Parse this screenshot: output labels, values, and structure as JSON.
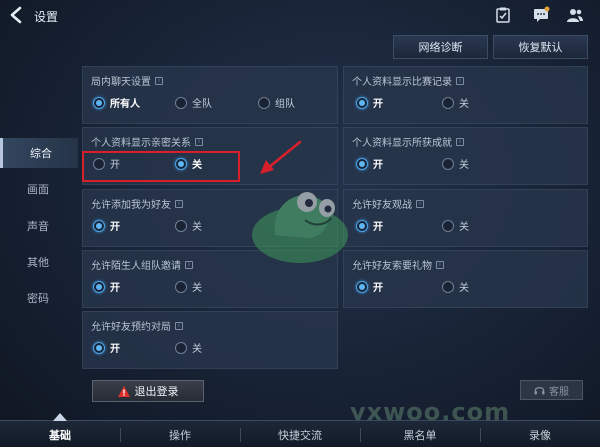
{
  "header": {
    "title": "设置"
  },
  "top_buttons": {
    "network": "网络诊断",
    "restore": "恢复默认"
  },
  "nav": [
    {
      "label": "综合",
      "active": true
    },
    {
      "label": "画面",
      "active": false
    },
    {
      "label": "声音",
      "active": false
    },
    {
      "label": "其他",
      "active": false
    },
    {
      "label": "密码",
      "active": false
    }
  ],
  "settings": {
    "ingame_chat": {
      "title": "局内聊天设置",
      "options": [
        "所有人",
        "全队",
        "组队"
      ],
      "selected": 0
    },
    "show_match_record": {
      "title": "个人资料显示比赛记录",
      "options": [
        "开",
        "关"
      ],
      "selected": 0
    },
    "show_intimacy": {
      "title": "个人资料显示亲密关系",
      "options": [
        "开",
        "关"
      ],
      "selected": 1
    },
    "show_achievements": {
      "title": "个人资料显示所获成就",
      "options": [
        "开",
        "关"
      ],
      "selected": 0
    },
    "allow_add_friend": {
      "title": "允许添加我为好友",
      "options": [
        "开",
        "关"
      ],
      "selected": 0
    },
    "allow_spectate": {
      "title": "允许好友观战",
      "options": [
        "开",
        "关"
      ],
      "selected": 0
    },
    "allow_stranger_invite": {
      "title": "允许陌生人组队邀请",
      "options": [
        "开",
        "关"
      ],
      "selected": 0
    },
    "allow_gift_request": {
      "title": "允许好友索要礼物",
      "options": [
        "开",
        "关"
      ],
      "selected": 0
    },
    "allow_reservation": {
      "title": "允许好友预约对局",
      "options": [
        "开",
        "关"
      ],
      "selected": 0
    }
  },
  "actions": {
    "logout": "退出登录",
    "customer_service": "客服"
  },
  "tabs": [
    {
      "label": "基础",
      "active": true
    },
    {
      "label": "操作",
      "active": false
    },
    {
      "label": "快捷交流",
      "active": false
    },
    {
      "label": "黑名单",
      "active": false
    },
    {
      "label": "录像",
      "active": false
    }
  ],
  "watermark": "yxwoo.com",
  "colors": {
    "accent": "#4aa3e8",
    "highlight": "#d8202a",
    "background": "#141d2b"
  }
}
